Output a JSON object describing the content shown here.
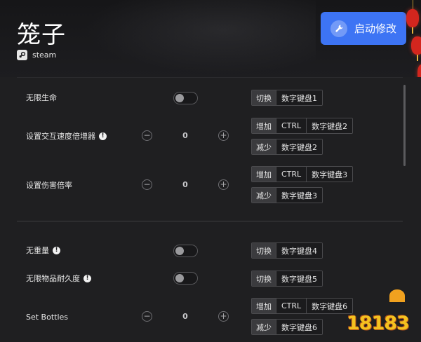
{
  "header": {
    "game_title": "笼子",
    "platform_label": "steam",
    "launch_button_label": "启动修改"
  },
  "cheats": [
    {
      "label": "无限生命",
      "has_info": false,
      "type": "toggle",
      "keys": [
        {
          "action": "切换",
          "keys": [
            "数字键盘1"
          ]
        }
      ]
    },
    {
      "label": "设置交互速度倍增器",
      "has_info": true,
      "type": "stepper",
      "value": "0",
      "keys": [
        {
          "action": "增加",
          "keys": [
            "CTRL",
            "数字键盘2"
          ]
        },
        {
          "action": "减少",
          "keys": [
            "数字键盘2"
          ]
        }
      ]
    },
    {
      "label": "设置伤害倍率",
      "has_info": false,
      "type": "stepper",
      "value": "0",
      "keys": [
        {
          "action": "增加",
          "keys": [
            "CTRL",
            "数字键盘3"
          ]
        },
        {
          "action": "减少",
          "keys": [
            "数字键盘3"
          ]
        }
      ]
    },
    {
      "label": "无重量",
      "has_info": true,
      "type": "toggle",
      "keys": [
        {
          "action": "切换",
          "keys": [
            "数字键盘4"
          ]
        }
      ]
    },
    {
      "label": "无限物品耐久度",
      "has_info": true,
      "type": "toggle",
      "keys": [
        {
          "action": "切换",
          "keys": [
            "数字键盘5"
          ]
        }
      ]
    },
    {
      "label": "Set Bottles",
      "has_info": false,
      "type": "stepper",
      "value": "0",
      "keys": [
        {
          "action": "增加",
          "keys": [
            "CTRL",
            "数字键盘6"
          ]
        },
        {
          "action": "减少",
          "keys": [
            "数字键盘6"
          ]
        }
      ]
    }
  ],
  "stepper_symbols": {
    "minus": "−",
    "plus": "+"
  },
  "info_symbol": "!",
  "watermark": "18183",
  "colors": {
    "accent": "#3d74f4",
    "background": "#1f1f21"
  },
  "icons": {
    "platform": "steam-icon",
    "launch": "wrench-icon",
    "info": "info-icon"
  }
}
